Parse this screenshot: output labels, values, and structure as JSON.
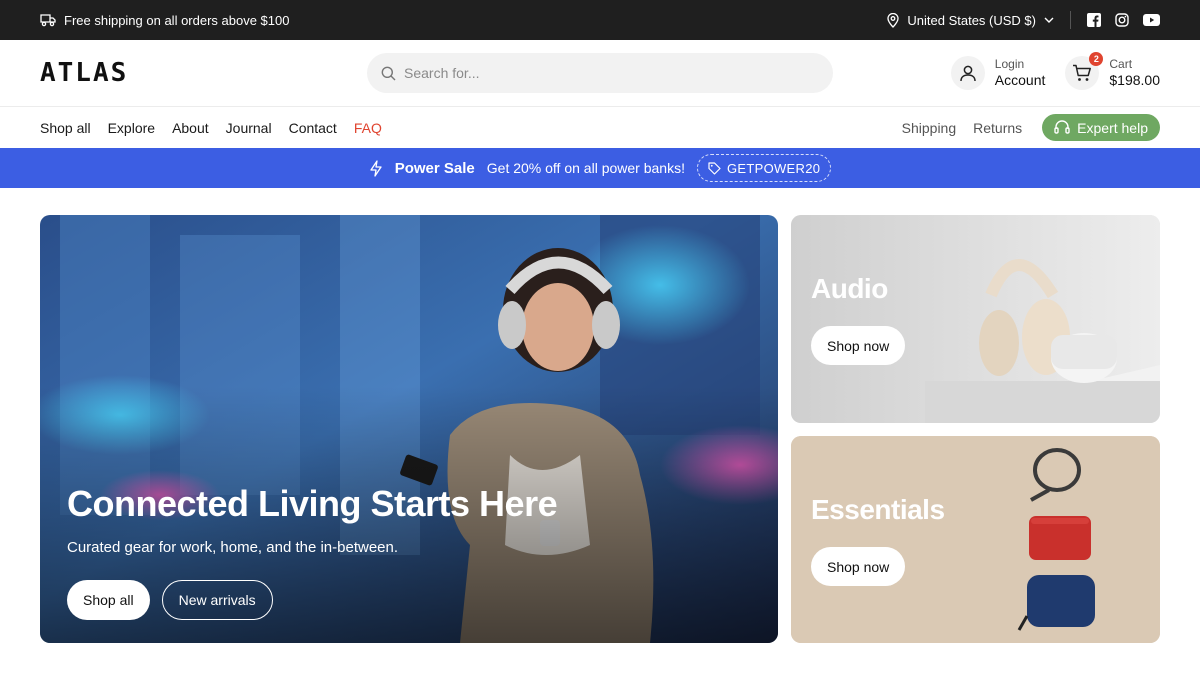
{
  "topbar": {
    "shipping_text": "Free shipping on all orders above $100",
    "region": "United States (USD $)",
    "icons": [
      "truck-icon",
      "location-pin-icon",
      "chevron-down-icon",
      "facebook-icon",
      "instagram-icon",
      "youtube-icon"
    ]
  },
  "header": {
    "logo": "ATLAS",
    "search_placeholder": "Search for...",
    "account_small": "Login",
    "account_big": "Account",
    "cart_small": "Cart",
    "cart_total": "$198.00",
    "cart_count": "2"
  },
  "nav": {
    "items": [
      "Shop all",
      "Explore",
      "About",
      "Journal",
      "Contact",
      "FAQ"
    ],
    "right_links": [
      "Shipping",
      "Returns"
    ],
    "expert_help": "Expert help"
  },
  "promo": {
    "title": "Power Sale",
    "text": "Get 20% off on all power banks!",
    "code": "GETPOWER20"
  },
  "hero": {
    "title": "Connected Living Starts Here",
    "subtitle": "Curated gear for work, home, and the in-between.",
    "primary_button": "Shop all",
    "secondary_button": "New arrivals"
  },
  "cards": [
    {
      "title": "Audio",
      "button": "Shop now"
    },
    {
      "title": "Essentials",
      "button": "Shop now"
    }
  ],
  "colors": {
    "topbar_bg": "#1f1f1f",
    "promo_bg": "#3c5ee3",
    "accent_red": "#e0442f",
    "expert_green": "#6fa862"
  }
}
